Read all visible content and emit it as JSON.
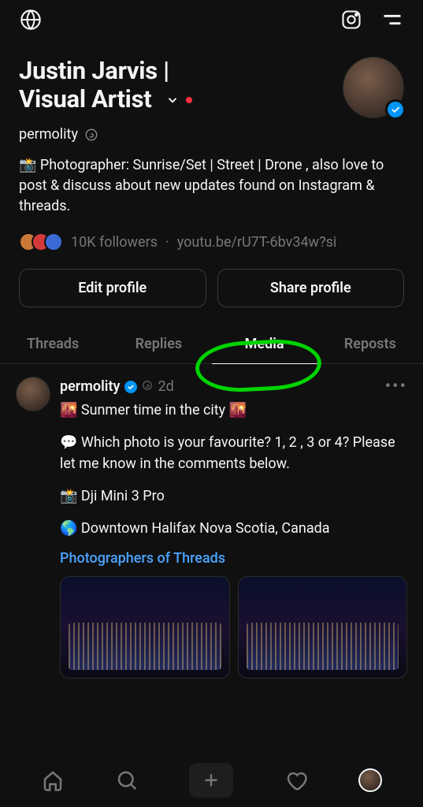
{
  "header": {
    "display_name_line1": "Justin Jarvis |",
    "display_name_line2": "Visual Artist",
    "handle": "permolity"
  },
  "bio": "📸 Photographer: Sunrise/Set | Street | Drone , also love to post & discuss about new updates found on Instagram & threads.",
  "stats": {
    "followers_text": "10K followers",
    "link_text": "youtu.be/rU7T-6bv34w?si"
  },
  "actions": {
    "edit_label": "Edit profile",
    "share_label": "Share profile"
  },
  "tabs": [
    "Threads",
    "Replies",
    "Media",
    "Reposts"
  ],
  "active_tab_index": 2,
  "post": {
    "user": "permolity",
    "time": "2d",
    "line1": "🌇 Sunmer time in the city 🌇",
    "line2": "💬 Which photo is your favourite? 1, 2 , 3 or 4? Please let me know in the comments below.",
    "line3": "📸 Dji Mini 3 Pro",
    "line4": "🌎 Downtown Halifax Nova Scotia, Canada",
    "topic_link": "Photographers of Threads"
  }
}
